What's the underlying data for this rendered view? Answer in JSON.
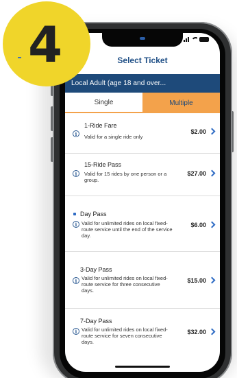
{
  "badge": {
    "number": "4"
  },
  "status_bar": {
    "time": "9"
  },
  "header": {
    "title": "Select Ticket"
  },
  "rider_type": {
    "label": "Local Adult (age 18 and over..."
  },
  "tabs": [
    {
      "label": "Single",
      "active": true
    },
    {
      "label": "Multiple",
      "active": false
    }
  ],
  "tickets": [
    {
      "name": "1-Ride Fare",
      "description": "Valid for a single ride only",
      "price": "$2.00"
    },
    {
      "name": "15-Ride Pass",
      "description_lines": [
        "Valid for 15 rides by one person or a",
        "group."
      ],
      "price": "$27.00"
    },
    {
      "name": "Day Pass",
      "description_lines": [
        "Valid for unlimited rides on local fixed-",
        "route service until the end of the service",
        "day."
      ],
      "price": "$6.00"
    },
    {
      "name": "3-Day Pass",
      "description_lines": [
        "Valid for unlimited rides on local fixed-",
        "route service for three consecutive",
        "days."
      ],
      "price": "$15.00"
    },
    {
      "name": "7-Day Pass",
      "description_lines": [
        "Valid for unlimited rides on local fixed-",
        "route service for seven consecutive",
        "days."
      ],
      "price": "$32.00"
    }
  ],
  "colors": {
    "badge": "#f0d52a",
    "header_text": "#1f4f86",
    "rider_bar": "#1e4a7a",
    "tab_accent": "#f3a24b",
    "chevron": "#2e6bc4"
  }
}
